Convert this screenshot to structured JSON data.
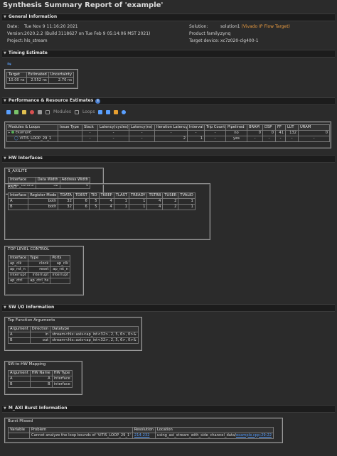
{
  "title": "Synthesis Summary Report of 'example'",
  "general": {
    "heading": "General Information",
    "date_label": "Date:",
    "date": "Tue Nov 9 11:16:20 2021",
    "version_label": "Version:",
    "version": "2020.2.2 (Build 3118627 on Tue Feb 9 05:14:06 MST 2021)",
    "project_label": "Project:",
    "project": "hls_stream",
    "solution_label": "Solution:",
    "solution": "solution1",
    "solution_flow": "(Vivado IP Flow Target)",
    "family_label": "Product family:",
    "family": "zynq",
    "device_label": "Target device:",
    "device": "xc7z020-clg400-1"
  },
  "timing": {
    "heading": "Timing Estimate",
    "headers": [
      "Target",
      "Estimated",
      "Uncertainty"
    ],
    "row": [
      "10.00 ns",
      "2.552 ns",
      "2.70 ns"
    ]
  },
  "perf": {
    "heading": "Performance & Resource Estimates",
    "toolbar": {
      "modules": "Modules",
      "loops": "Loops"
    },
    "headers": [
      "Modules & Loops",
      "Issue Type",
      "Slack",
      "Latency(cycles)",
      "Latency(ns)",
      "Iteration Latency",
      "Interval",
      "Trip Count",
      "Pipelined",
      "BRAM",
      "DSP",
      "FF",
      "LUT",
      "URAM"
    ],
    "rows": [
      [
        "example",
        "",
        "-",
        "-",
        "-",
        "-",
        "-",
        "-",
        "no",
        "0",
        "0",
        "41",
        "132",
        "0"
      ],
      [
        "VITIS_LOOP_29_1",
        "",
        "-",
        "-",
        "-",
        "2",
        "1",
        "-",
        "yes",
        "-",
        "-",
        "-",
        "-",
        "-"
      ]
    ]
  },
  "hw": {
    "heading": "HW Interfaces",
    "saxi": {
      "title": "S_AXILITE",
      "headers": [
        "Interface",
        "Data Width",
        "Address Width"
      ],
      "row": [
        "s_axi_control",
        "32",
        "4"
      ]
    },
    "axis": {
      "title": "AXIS",
      "headers": [
        "Interface",
        "Register Mode",
        "TDATA",
        "TDEST",
        "TID",
        "TKEEP",
        "TLAST",
        "TREADY",
        "TSTRB",
        "TUSER",
        "TVALID"
      ],
      "rows": [
        [
          "A",
          "both",
          "32",
          "6",
          "5",
          "4",
          "1",
          "1",
          "4",
          "2",
          "1"
        ],
        [
          "B",
          "both",
          "32",
          "6",
          "5",
          "4",
          "1",
          "1",
          "4",
          "2",
          "1"
        ]
      ]
    },
    "toplevel": {
      "title": "TOP LEVEL CONTROL",
      "headers": [
        "Interface",
        "Type",
        "Ports"
      ],
      "rows": [
        [
          "ap_clk",
          "clock",
          "ap_clk"
        ],
        [
          "ap_rst_n",
          "reset",
          "ap_rst_n"
        ],
        [
          "interrupt",
          "interrupt",
          "interrupt"
        ],
        [
          "ap_ctrl",
          "ap_ctrl_hs",
          ""
        ]
      ]
    }
  },
  "swio": {
    "heading": "SW I/O Information",
    "topfunc": {
      "title": "Top Function Arguments",
      "headers": [
        "Argument",
        "Direction",
        "Datatype"
      ],
      "rows": [
        [
          "A",
          "in",
          "stream<hls::axis<ap_int<32>, 2, 5, 6>, 0>&"
        ],
        [
          "B",
          "out",
          "stream<hls::axis<ap_int<32>, 2, 5, 6>, 0>&"
        ]
      ]
    },
    "sw2hw": {
      "title": "SW-to-HW Mapping",
      "headers": [
        "Argument",
        "HW Name",
        "HW Type"
      ],
      "rows": [
        [
          "A",
          "A",
          "interface"
        ],
        [
          "B",
          "B",
          "interface"
        ]
      ]
    }
  },
  "maxi": {
    "heading": "M_AXI Burst Information",
    "burst": {
      "title": "Burst Missed",
      "headers": [
        "Variable",
        "Problem",
        "Resolution",
        "Location"
      ],
      "row": [
        "",
        "Cannot analyze the loop bounds of 'VITIS_LOOP_29_1'",
        "214-232",
        "using_axi_stream_with_side_channel_data/",
        "example.cpp:29:22"
      ]
    }
  }
}
